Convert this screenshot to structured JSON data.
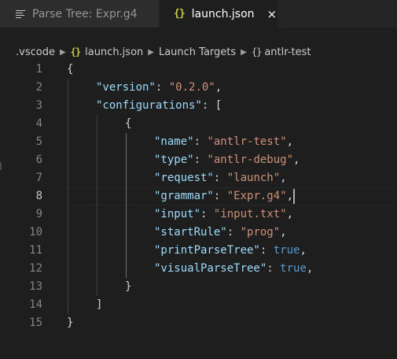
{
  "tabs": [
    {
      "label": "Parse Tree: Expr.g4",
      "active": false,
      "icon": "file-lines-icon"
    },
    {
      "label": "launch.json",
      "active": true,
      "icon": "json-braces-icon",
      "close": "×"
    }
  ],
  "breadcrumb": {
    "segments": [
      ".vscode",
      "launch.json",
      "Launch Targets",
      "antlr-test"
    ],
    "separator_icon": "chevron-right-icon"
  },
  "editor": {
    "language": "json",
    "current_line": 8,
    "lines": [
      {
        "n": "1",
        "text": "{"
      },
      {
        "n": "2",
        "text": "\"version\": \"0.2.0\","
      },
      {
        "n": "3",
        "text": "\"configurations\": ["
      },
      {
        "n": "4",
        "text": "{"
      },
      {
        "n": "5",
        "text": "\"name\": \"antlr-test\","
      },
      {
        "n": "6",
        "text": "\"type\": \"antlr-debug\","
      },
      {
        "n": "7",
        "text": "\"request\": \"launch\","
      },
      {
        "n": "8",
        "text": "\"grammar\": \"Expr.g4\","
      },
      {
        "n": "9",
        "text": "\"input\": \"input.txt\","
      },
      {
        "n": "10",
        "text": "\"startRule\": \"prog\","
      },
      {
        "n": "11",
        "text": "\"printParseTree\": true,"
      },
      {
        "n": "12",
        "text": "\"visualParseTree\": true,"
      },
      {
        "n": "13",
        "text": "}"
      },
      {
        "n": "14",
        "text": "]"
      },
      {
        "n": "15",
        "text": "}"
      }
    ]
  },
  "colors": {
    "background": "#1e1e1e",
    "key": "#9cdcfe",
    "string": "#ce9178",
    "boolean": "#569cd6",
    "json_icon": "#cbcb41"
  }
}
